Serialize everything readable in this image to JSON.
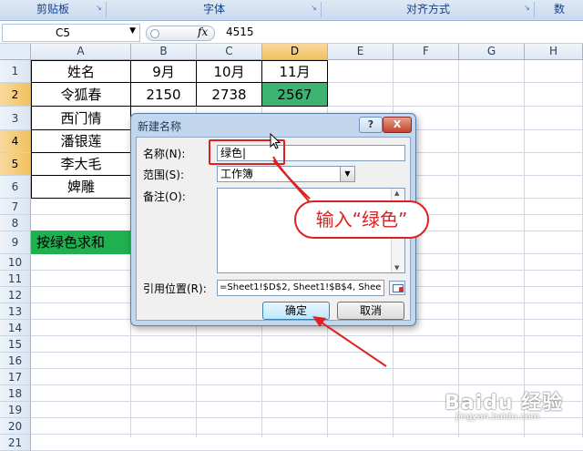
{
  "ribbon": {
    "groups": [
      "剪贴板",
      "字体",
      "对齐方式",
      "数"
    ]
  },
  "formula_bar": {
    "name_box": "C5",
    "fx": "fx",
    "value": "4515"
  },
  "columns": [
    "A",
    "B",
    "C",
    "D",
    "E",
    "F",
    "G",
    "H"
  ],
  "selected_column": "D",
  "rows": [
    "1",
    "2",
    "3",
    "4",
    "5",
    "6",
    "7",
    "8",
    "9",
    "10",
    "11",
    "12",
    "13",
    "14",
    "15",
    "16",
    "17",
    "18",
    "19",
    "20",
    "21"
  ],
  "selected_rows": [
    "2",
    "4",
    "5"
  ],
  "sheet": {
    "header": [
      "姓名",
      "9月",
      "10月",
      "11月"
    ],
    "names": [
      "令狐春",
      "西门情",
      "潘银莲",
      "李大毛",
      "婢雕"
    ],
    "row2": [
      "2150",
      "2738",
      "2567"
    ],
    "a9": "按绿色求和"
  },
  "dialog": {
    "title": "新建名称",
    "help": "?",
    "close": "X",
    "name_label": "名称(N):",
    "name_value": "绿色|",
    "scope_label": "范围(S):",
    "scope_value": "工作簿",
    "comment_label": "备注(O):",
    "ref_label": "引用位置(R):",
    "ref_value": "=Sheet1!$D$2, Sheet1!$B$4, Shee",
    "ok": "确定",
    "cancel": "取消"
  },
  "annotation": {
    "callout": "输入“绿色”",
    "color": "#e02020"
  },
  "watermark": {
    "text": "Baidu 经验",
    "sub": "jingyan.baidu.com"
  }
}
